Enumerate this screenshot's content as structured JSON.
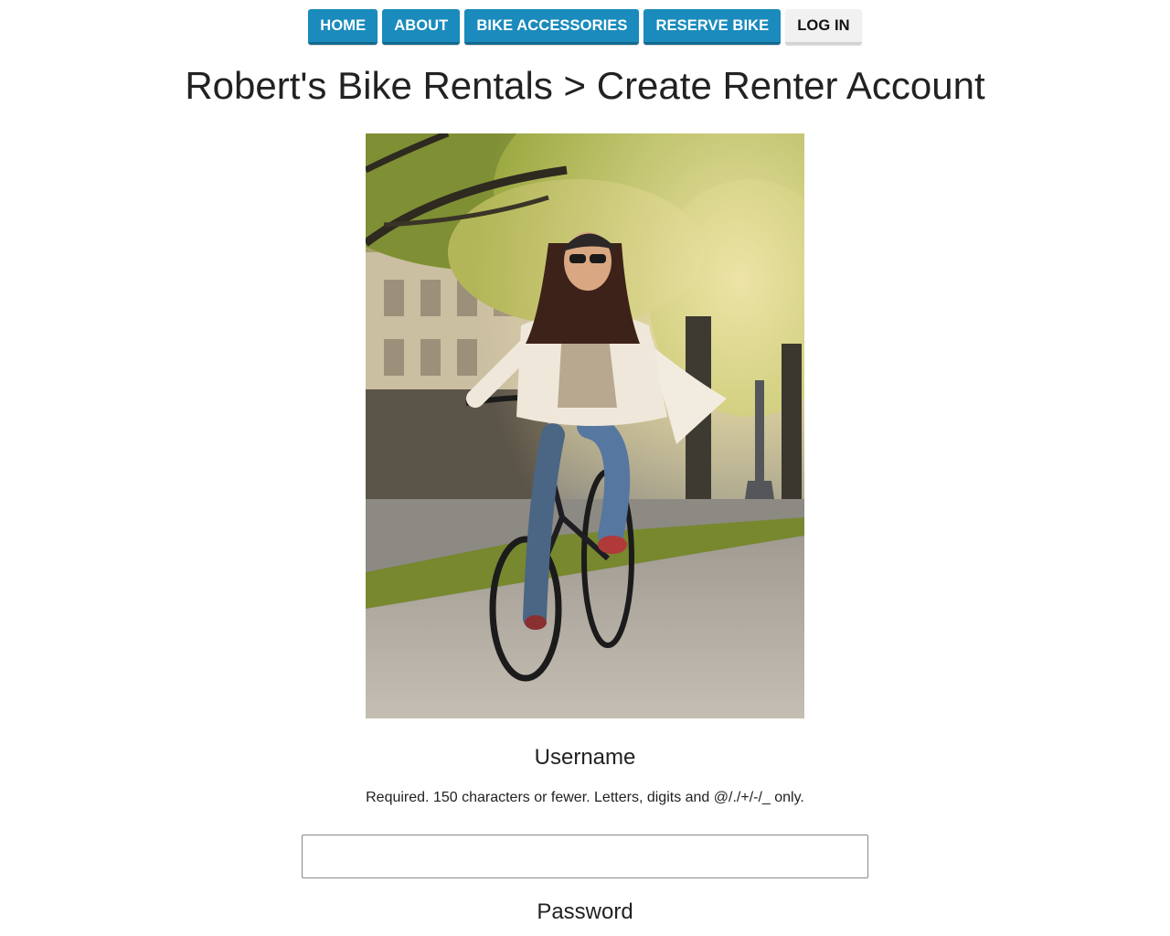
{
  "nav": {
    "items": [
      {
        "label": "HOME"
      },
      {
        "label": "ABOUT"
      },
      {
        "label": "BIKE ACCESSORIES"
      },
      {
        "label": "RESERVE BIKE"
      },
      {
        "label": "LOG IN"
      }
    ],
    "accent_color": "#1a8bbc",
    "active_item": "LOG IN"
  },
  "page": {
    "title": "Robert's Bike Rentals > Create Renter Account"
  },
  "form": {
    "username": {
      "label": "Username",
      "help": "Required. 150 characters or fewer. Letters, digits and @/./+/-/_ only.",
      "value": ""
    },
    "password": {
      "label": "Password"
    }
  }
}
